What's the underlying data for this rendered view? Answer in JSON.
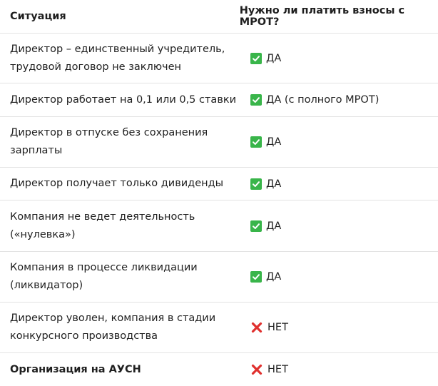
{
  "header": {
    "situation": "Ситуация",
    "answer": "Нужно ли платить взносы с МРОТ?"
  },
  "rows": [
    {
      "line1": "Директор – единственный учредитель,",
      "line2": "трудовой договор не заключен",
      "answer": "ДА",
      "status": "yes"
    },
    {
      "line1": "Директор работает на 0,1 или 0,5 ставки",
      "line2": "",
      "answer": "ДА (с полного МРОТ)",
      "status": "yes"
    },
    {
      "line1": "Директор в отпуске без сохранения",
      "line2": "зарплаты",
      "answer": "ДА",
      "status": "yes"
    },
    {
      "line1": "Директор получает только дивиденды",
      "line2": "",
      "answer": "ДА",
      "status": "yes"
    },
    {
      "line1": "Компания не ведет деятельность",
      "line2": "(«нулевка»)",
      "answer": "ДА",
      "status": "yes"
    },
    {
      "line1": "Компания в процессе ликвидации",
      "line2": "(ликвидатор)",
      "answer": "ДА",
      "status": "yes"
    },
    {
      "line1": "Директор уволен, компания в стадии",
      "line2": "конкурсного производства",
      "answer": "НЕТ",
      "status": "no"
    },
    {
      "line1": "Организация на АУСН",
      "line2": "",
      "answer": "НЕТ",
      "status": "no"
    }
  ],
  "icons": {
    "yes": "check-mark-button-icon",
    "no": "cross-mark-icon"
  },
  "colors": {
    "yes_icon": "#39b54a",
    "no_icon": "#e0302e",
    "divider": "#e3e3e3"
  }
}
